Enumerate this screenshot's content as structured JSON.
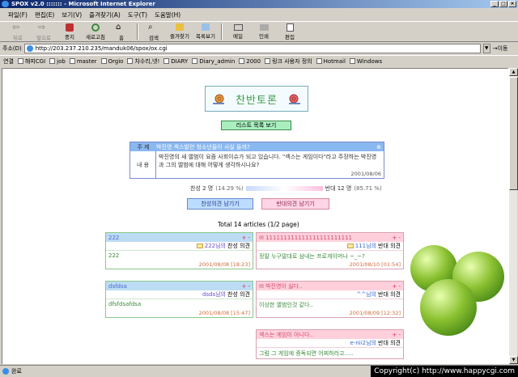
{
  "window": {
    "title": "SPOX v2.0 ::::::: - Microsoft Internet Explorer"
  },
  "menu": [
    "파일(F)",
    "편집(E)",
    "보기(V)",
    "즐겨찾기(A)",
    "도구(T)",
    "도움말(H)"
  ],
  "toolbar": {
    "back": "뒤로",
    "forward": "앞으로",
    "stop": "중지",
    "refresh": "새로고침",
    "home": "홈",
    "search": "검색",
    "favorites": "즐겨찾기",
    "history": "목록보기",
    "mail": "메일",
    "print": "인쇄",
    "edit": "편집"
  },
  "address": {
    "label": "주소(D)",
    "url": "http://203.237.210.235/manduk06/spox/ox.cgi",
    "go": "이동"
  },
  "links": {
    "label": "연결",
    "items": [
      "해피CGI",
      "job",
      "master",
      "Orgio",
      "차수리,넷!",
      "DIARY",
      "Diary_admin",
      "2000",
      "링크 사용자 정의",
      "Hotmail",
      "Windows"
    ]
  },
  "page": {
    "logo": "찬반토론",
    "list_button": "리스트 목록 보기",
    "topic": {
      "label_title": "주 제",
      "title": "박진영 섹스발언 청소년들이 사실 들까?",
      "label_content": "내 용",
      "content": "박진영의 새 앨범이 요즘 사회이슈가 되고 있습니다. \"섹스는 게임이다\"라고 주장하는 박진영과 그의 앨범에 대해 어떻게 생각하시나요?",
      "date": "2001/08/06"
    },
    "vote": {
      "pro": "찬성 2 명",
      "pro_pct": "(14.29 %)",
      "con": "반대 12 명",
      "con_pct": "(85.71 %)",
      "pro_ratio": 0.1429
    },
    "pro_button": "찬성의견 남기기",
    "con_button": "반대의견 남기기",
    "total": "Total 14 articles (1/2 page)",
    "pro_cards": [
      {
        "title": "222",
        "nick": "222님의",
        "side": "찬성 의견",
        "text": "222",
        "date": "2001/08/08 [18:23]"
      },
      {
        "title": "dsfdsa",
        "nick": "dsds님의",
        "side": "찬성 의견",
        "text": "dfsfdsafdsa",
        "date": "2001/08/08 [15:47]"
      }
    ],
    "con_cards": [
      {
        "title": "111111111111111111111111",
        "nick": "111님의",
        "side": "반대 의견",
        "text": "정말 누구말대로 삼내는 프로게이머나 ~_~?",
        "date": "2001/08/10 [01:54]"
      },
      {
        "title": "박진영이 싫다..",
        "nick": "^^님의",
        "side": "반대 의견",
        "text": "이상한 앨범인것 같다..",
        "date": "2001/08/09 [12:32]"
      },
      {
        "title": "섹스는 게임이 아니다..",
        "nick": "e-nii2님의",
        "side": "반대 의견",
        "text": "그럼 그 게임에 중독되면 어찌하라고.....",
        "date": ""
      }
    ],
    "plus_minus": "+ -"
  },
  "status": {
    "text": "완료",
    "copyright": "Copyright(c) http://www.happycgi.com"
  }
}
